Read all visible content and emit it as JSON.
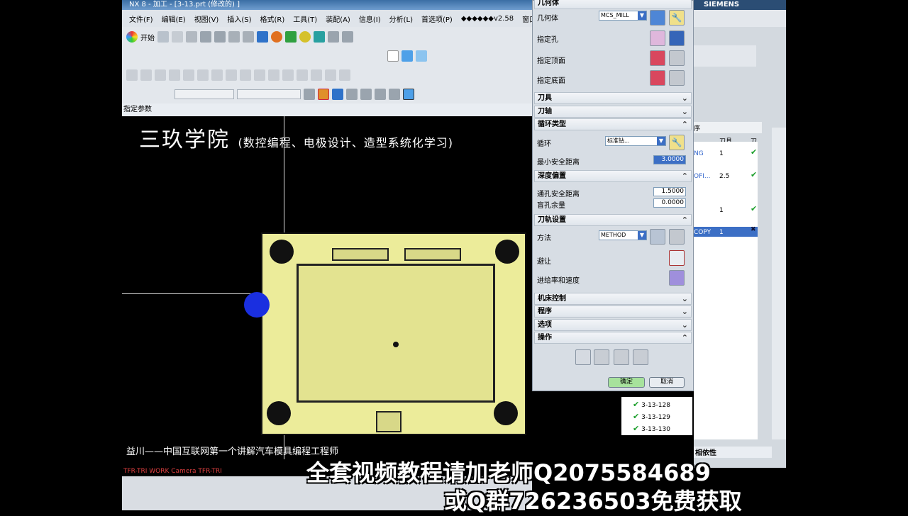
{
  "window": {
    "title": "NX 8 - 加工 - [3-13.prt  (修改的) ]"
  },
  "menu": [
    "文件(F)",
    "编辑(E)",
    "视图(V)",
    "插入(S)",
    "格式(R)",
    "工具(T)",
    "装配(A)",
    "信息(I)",
    "分析(L)",
    "首选项(P)",
    "◆◆◆◆◆◆v2.58",
    "窗口(O)"
  ],
  "toolbar": {
    "start_label": "开始"
  },
  "param_label": "指定参数",
  "watermark": {
    "title": "三玖学院",
    "subtitle": "(数控编程、电极设计、造型系统化学习)"
  },
  "dialog": {
    "geometry_header": "几何体",
    "geometry_label": "几何体",
    "geometry_value": "MCS_MILL",
    "specify_hole": "指定孔",
    "specify_top": "指定顶面",
    "specify_bottom": "指定底面",
    "tool": "刀具",
    "axis": "刀轴",
    "cycle_type": "循环类型",
    "cycle": "循环",
    "cycle_value": "标准钻...",
    "min_clearance": "最小安全距离",
    "min_clearance_value": "3.0000",
    "depth_offset": "深度偏置",
    "through_clearance": "通孔安全距离",
    "through_clearance_value": "1.5000",
    "blind_stock": "盲孔余量",
    "blind_stock_value": "0.0000",
    "path_settings": "刀轨设置",
    "method": "方法",
    "method_value": "METHOD",
    "avoid": "避让",
    "feeds": "进给率和速度",
    "machine_control": "机床控制",
    "program": "程序",
    "options": "选项",
    "actions": "操作",
    "ok": "确定",
    "cancel": "取消"
  },
  "rightpanel": {
    "brand": "SIEMENS",
    "column_order": "序",
    "column_tool": "刀具",
    "column_extra": "刀",
    "rows": [
      {
        "name": "NG",
        "tool": "1"
      },
      {
        "name": "OFI...",
        "tool": "2.5"
      },
      {
        "name": "",
        "tool": "1"
      },
      {
        "name": "COPY",
        "tool": "1"
      }
    ],
    "tree": [
      "3-13-128",
      "3-13-129",
      "3-13-130"
    ],
    "dependency": "相依性"
  },
  "caption": "益川——中国互联网第一个讲解汽车模具编程工程师",
  "camera": "TFR-TRI WORK Camera TFR-TRI",
  "banner": {
    "line1": "全套视频教程请加老师Q2075584689",
    "line2": "或Q群726236503免费获取"
  },
  "colors": {
    "part": "#ecec9a",
    "dialog": "#d7dde4",
    "accent": "#3c6fc5"
  }
}
